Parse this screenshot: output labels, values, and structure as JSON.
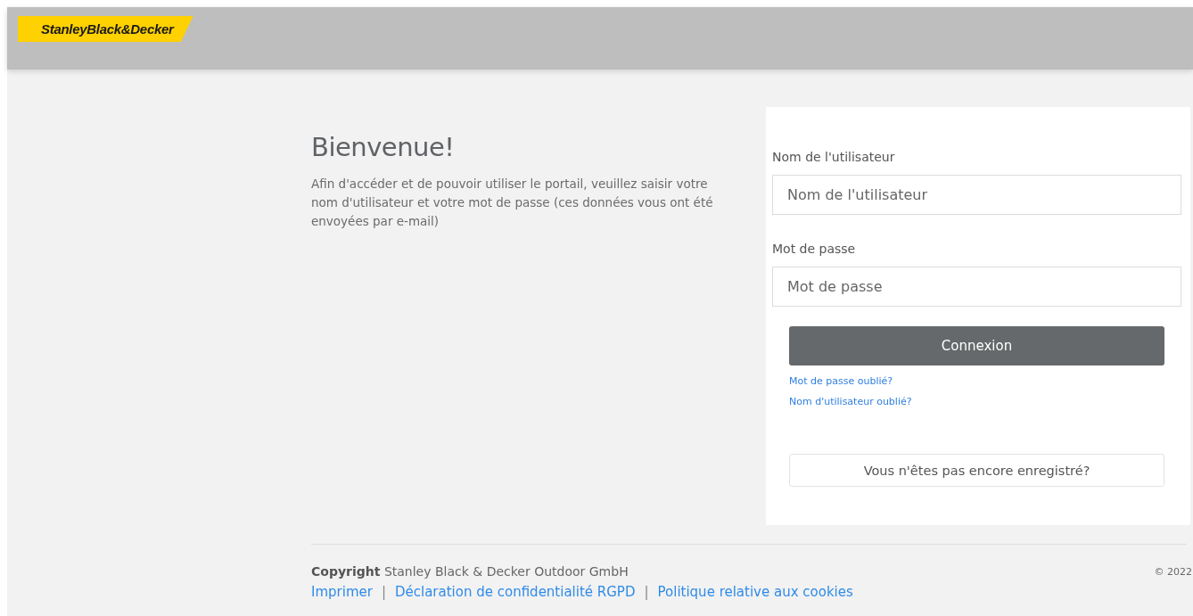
{
  "header": {
    "logo": "StanleyBlack&Decker"
  },
  "welcome": {
    "title": "Bienvenue!",
    "text": "Afin d'accéder et de pouvoir utiliser le portail, veuillez saisir votre nom d'utilisateur et votre mot de passe (ces données vous ont été envoyées par e-mail)"
  },
  "login": {
    "fields": [
      {
        "label": "Nom de l'utilisateur",
        "placeholder": "Nom de l'utilisateur"
      },
      {
        "label": "Mot de passe",
        "placeholder": "Mot de passe"
      }
    ],
    "submit": "Connexion",
    "links": [
      "Mot de passe oublié?",
      "Nom d'utilisateur oublié?"
    ],
    "register": "Vous n'êtes pas encore enregistré?"
  },
  "footer": {
    "copyright": "**Copyright** Stanley Black & Decker Outdoor GmbH",
    "year": "© 2022",
    "items": [
      {
        "kind": "link",
        "text": "Imprimer"
      },
      {
        "kind": "separator",
        "text": "|"
      },
      {
        "kind": "link",
        "text": "Déclaration de confidentialité RGPD"
      },
      {
        "kind": "separator",
        "text": "|"
      },
      {
        "kind": "link",
        "text": "Politique relative aux cookies"
      }
    ]
  }
}
